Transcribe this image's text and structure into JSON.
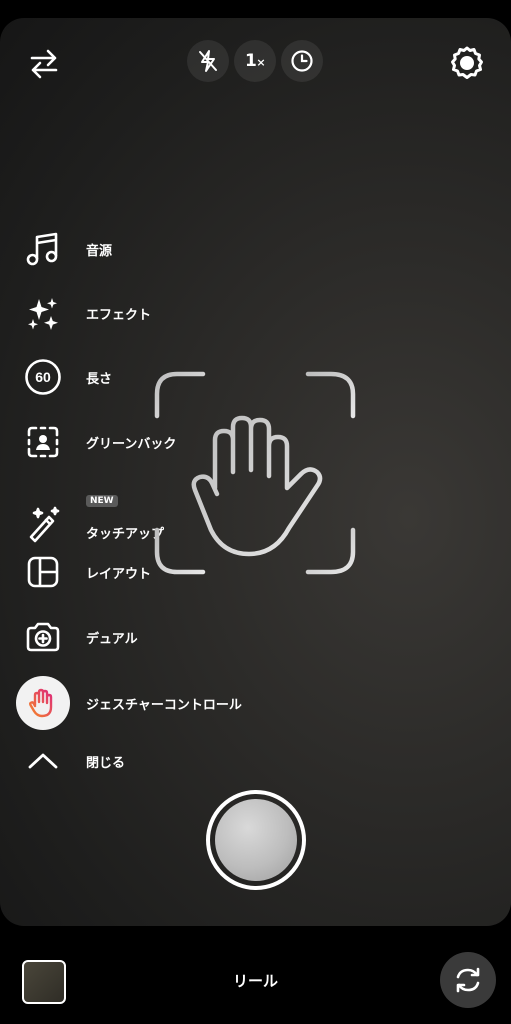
{
  "top_bar": {
    "swap_icon": "swap-arrows-icon",
    "flash_icon": "flash-off-icon",
    "zoom": "1",
    "zoom_suffix": "×",
    "timer_icon": "timer-icon",
    "settings_icon": "settings-gear-icon"
  },
  "menu": {
    "items": [
      {
        "label": "音源",
        "icon": "music-note-icon"
      },
      {
        "label": "エフェクト",
        "icon": "sparkles-icon"
      },
      {
        "label": "長さ",
        "icon": "duration-60-icon",
        "icon_text": "60"
      },
      {
        "label": "グリーンバック",
        "icon": "green-screen-icon"
      },
      {
        "label": "タッチアップ",
        "icon": "magic-wand-icon",
        "badge": "NEW"
      },
      {
        "label": "レイアウト",
        "icon": "layout-icon"
      },
      {
        "label": "デュアル",
        "icon": "dual-camera-icon"
      },
      {
        "label": "ジェスチャーコントロール",
        "icon": "gesture-hand-icon",
        "active": true
      },
      {
        "label": "閉じる",
        "icon": "chevron-up-icon"
      }
    ]
  },
  "center_overlay": {
    "icon": "hand-gesture-frame-icon"
  },
  "bottom_bar": {
    "mode_label": "リール",
    "gallery_icon": "gallery-thumbnail",
    "flip_icon": "flip-camera-icon"
  },
  "colors": {
    "background": "#000000",
    "viewfinder": "#2b2a28",
    "gesture_gradient_start": "#f58529",
    "gesture_gradient_end": "#dd2a7b"
  }
}
